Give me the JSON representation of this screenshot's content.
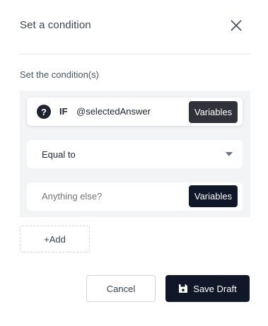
{
  "dialog": {
    "title": "Set a condition",
    "close_icon": "close-icon"
  },
  "section": {
    "label": "Set the condition(s)"
  },
  "condition": {
    "help_icon": "question-circle-icon",
    "if_label": "IF",
    "variable": "@selectedAnswer",
    "variables_button_label": "Variables"
  },
  "operator": {
    "selected": "Equal to",
    "caret_icon": "caret-down-icon"
  },
  "comparison": {
    "placeholder": "Anything else?",
    "value": "",
    "variables_button_label": "Variables"
  },
  "add_button_label": "+Add",
  "footer": {
    "cancel_label": "Cancel",
    "save_label": "Save Draft",
    "save_icon": "floppy-disk-icon"
  },
  "colors": {
    "primary": "#0f1729",
    "panel_bg": "#f3f4f6"
  }
}
